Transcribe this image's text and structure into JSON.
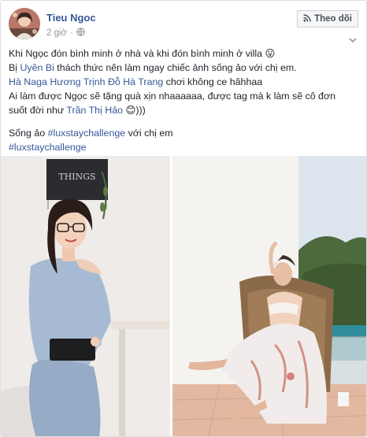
{
  "author": {
    "name": "Tieu Ngoc"
  },
  "meta": {
    "time": "2 giờ",
    "separator": "·",
    "privacy_icon": "globe-icon",
    "options_icon": "chevron-down-icon"
  },
  "follow_button": {
    "label": "Theo dõi",
    "icon": "rss-icon"
  },
  "post": {
    "line1": "Khi Ngọc đón bình minh ở nhà và khi đón bình minh ở villa",
    "line1_emoji": "😛",
    "line2_pre": "Bị ",
    "line2_mention": "Uyên Bi",
    "line2_post": " thách thức nên làm ngay chiếc ảnh sống ảo với chị em.",
    "line3_mention1": "Hà Naga Hương Trịnh",
    "line3_mention2": "Đỗ Hà Trang",
    "line3_post": " chơi không ce hâhhaa",
    "line4": "Ai làm được Ngọc sẽ tặng quà xịn nhaaaaaa, được tag mà k làm sẽ cô đơn",
    "line5_pre": "suốt đời như ",
    "line5_mention": "Trần Thị Hảo",
    "line5_emoji": "😊",
    "line5_post": ")))",
    "line6_pre": "Sống ảo ",
    "line6_hashtag": "#luxstaychallenge",
    "line6_post": " với chị em",
    "line7_hashtag": "#luxstaychallenge"
  },
  "photos": {
    "left": {
      "wall_sign": "THINGS"
    }
  },
  "colors": {
    "link": "#365899",
    "meta": "#90949c",
    "text": "#1d2129",
    "button_bg": "#f5f6f7"
  }
}
